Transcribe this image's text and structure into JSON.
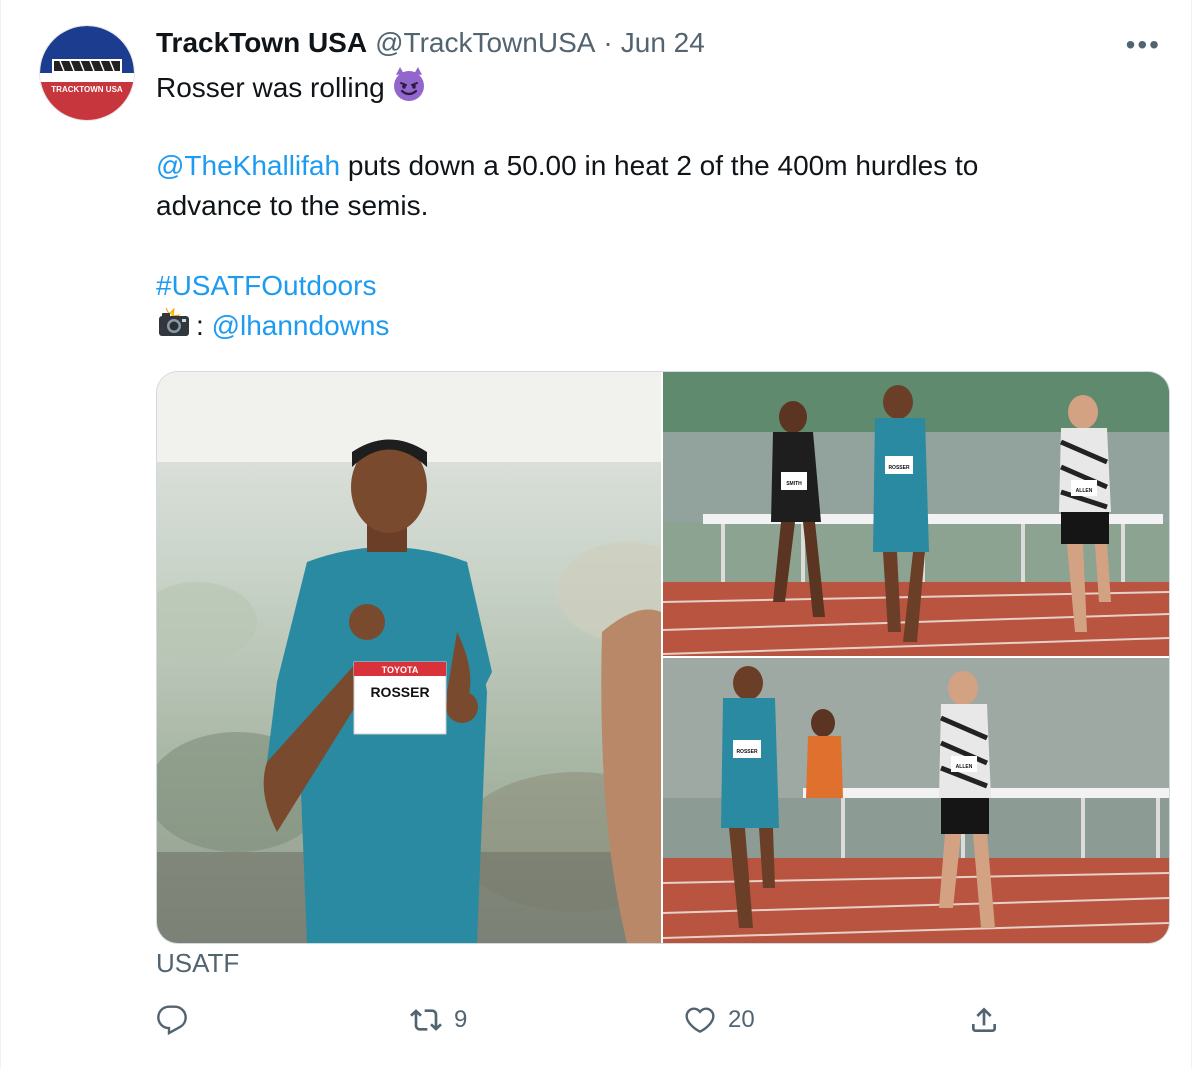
{
  "tweet": {
    "display_name": "TrackTown USA",
    "handle": "@TrackTownUSA",
    "separator": "·",
    "date": "Jun 24",
    "more_label": "•••",
    "avatar_text": "TRACKTOWN USA",
    "line1": "Rosser was rolling",
    "line2_mention": "@TheKhallifah",
    "line2_rest": " puts down a 50.00 in heat 2 of the 400m hurdles to",
    "line3": "advance to the semis.",
    "hashtag": "#USATFOutdoors",
    "credit_sep": ":",
    "credit_mention": "@lhanndowns",
    "media_caption": "USATF",
    "photo_bibs": {
      "main": "ROSSER",
      "main_brand": "TOYOTA",
      "top_left": "SMITH",
      "top_mid": "ROSSER",
      "top_right": "ALLEN",
      "bottom_left": "ROSSER",
      "bottom_right": "ALLEN"
    }
  },
  "actions": {
    "reply_count": "",
    "retweet_count": "9",
    "like_count": "20"
  },
  "colors": {
    "link": "#1d9bf0",
    "secondary_text": "#536471",
    "track": "#b8543f",
    "kit": "#2a8aa1"
  },
  "icons": [
    "smiling-devil-emoji",
    "camera-flash-emoji",
    "reply-icon",
    "retweet-icon",
    "like-icon",
    "share-icon"
  ]
}
